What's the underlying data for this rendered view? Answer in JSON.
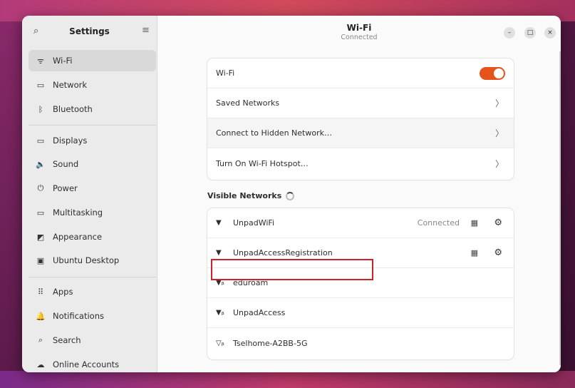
{
  "sidebar": {
    "title": "Settings",
    "items": [
      {
        "label": "Wi-Fi",
        "icon": "wifi-icon",
        "glyph": "ᯤ"
      },
      {
        "label": "Network",
        "icon": "network-icon",
        "glyph": "▭"
      },
      {
        "label": "Bluetooth",
        "icon": "bluetooth-icon",
        "glyph": "ᛒ"
      },
      {
        "label": "Displays",
        "icon": "display-icon",
        "glyph": "▭"
      },
      {
        "label": "Sound",
        "icon": "sound-icon",
        "glyph": "🔈"
      },
      {
        "label": "Power",
        "icon": "power-icon",
        "glyph": "⏻"
      },
      {
        "label": "Multitasking",
        "icon": "multitasking-icon",
        "glyph": "▭"
      },
      {
        "label": "Appearance",
        "icon": "appearance-icon",
        "glyph": "◩"
      },
      {
        "label": "Ubuntu Desktop",
        "icon": "ubuntu-desktop-icon",
        "glyph": "▣"
      },
      {
        "label": "Apps",
        "icon": "apps-icon",
        "glyph": "⠿"
      },
      {
        "label": "Notifications",
        "icon": "bell-icon",
        "glyph": "🔔"
      },
      {
        "label": "Search",
        "icon": "search-icon",
        "glyph": "⌕"
      },
      {
        "label": "Online Accounts",
        "icon": "cloud-icon",
        "glyph": "☁"
      }
    ]
  },
  "header": {
    "title": "Wi-Fi",
    "subtitle": "Connected"
  },
  "wifi_card": {
    "wifi_label": "Wi-Fi",
    "wifi_enabled": true,
    "saved_networks": "Saved Networks",
    "hidden_network": "Connect to Hidden Network…",
    "hotspot": "Turn On Wi-Fi Hotspot…"
  },
  "visible_networks": {
    "title": "Visible Networks",
    "networks": [
      {
        "name": "UnpadWiFi",
        "status": "Connected",
        "secured": false
      },
      {
        "name": "UnpadAccessRegistration",
        "status": "",
        "secured": false
      },
      {
        "name": "eduroam",
        "status": "",
        "secured": true
      },
      {
        "name": "UnpadAccess",
        "status": "",
        "secured": true
      },
      {
        "name": "Tselhome-A2BB-5G",
        "status": "",
        "secured": true
      }
    ]
  },
  "colors": {
    "accent": "#e5531a",
    "highlight_box": "#d0202a"
  }
}
